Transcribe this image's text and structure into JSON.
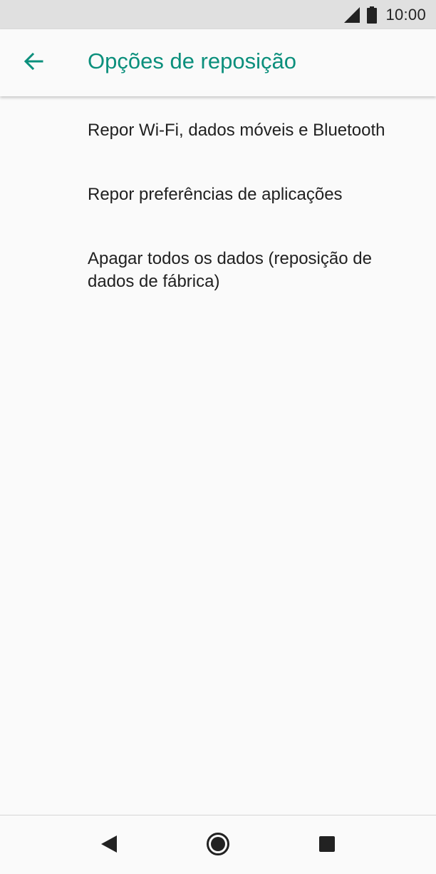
{
  "status_bar": {
    "time": "10:00",
    "icons": [
      "signal-icon",
      "battery-icon"
    ]
  },
  "app_bar": {
    "back_icon": "arrow-left-icon",
    "title": "Opções de reposição"
  },
  "menu": {
    "items": [
      {
        "label": "Repor Wi-Fi, dados móveis e Bluetooth"
      },
      {
        "label": "Repor preferências de aplicações"
      },
      {
        "label": "Apagar todos os dados (reposição de dados de fábrica)"
      }
    ]
  },
  "nav_bar": {
    "icons": [
      "nav-back-icon",
      "nav-home-icon",
      "nav-recents-icon"
    ]
  },
  "colors": {
    "accent": "#0b8f7c",
    "background": "#fafafa",
    "status_bar": "#e0e0e0",
    "text": "#212121"
  }
}
